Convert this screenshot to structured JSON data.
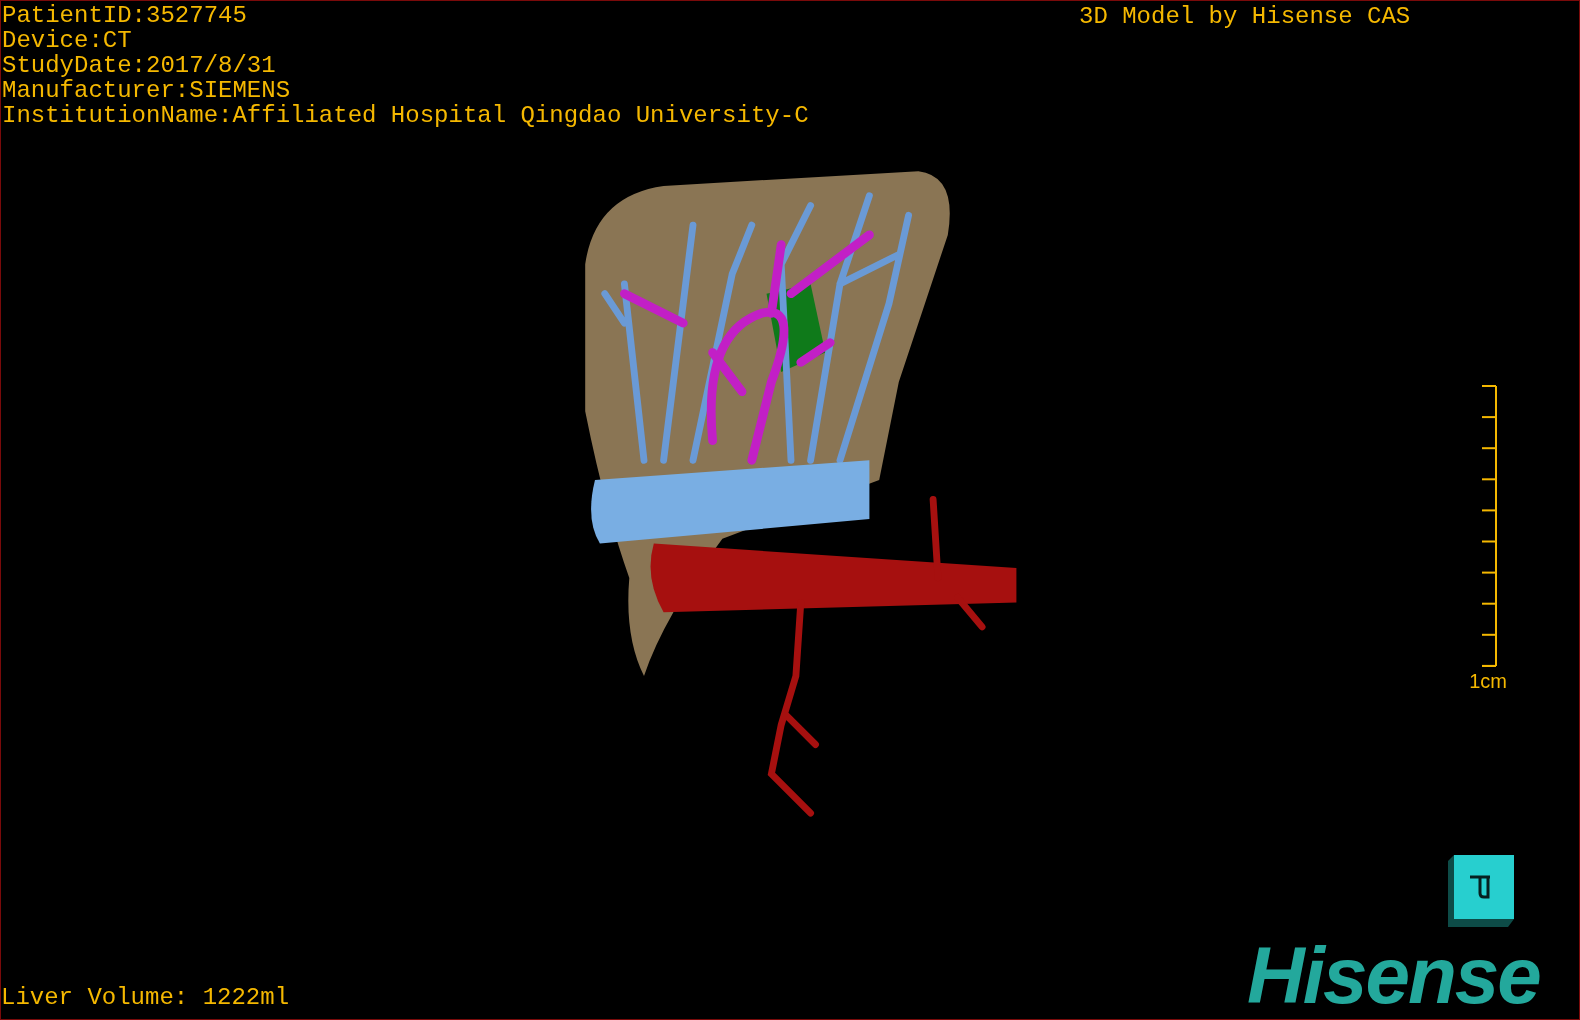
{
  "viewport": {
    "info_lines": [
      "PatientID:3527745",
      "Device:CT",
      "StudyDate:2017/8/31",
      "Manufacturer:SIEMENS",
      "InstitutionName:Affiliated Hospital Qingdao University-C"
    ],
    "title": "3D Model by Hisense CAS",
    "scale_bar": {
      "label": "1cm"
    },
    "volume": "Liver Volume: 1222ml",
    "logo": "Hisense"
  }
}
